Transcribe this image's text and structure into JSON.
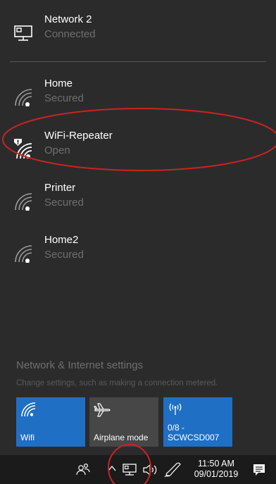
{
  "networks": [
    {
      "name": "Network 2",
      "status": "Connected",
      "icon": "ethernet-icon"
    },
    {
      "name": "Home",
      "status": "Secured",
      "icon": "wifi-secured-icon"
    },
    {
      "name": "WiFi-Repeater",
      "status": "Open",
      "icon": "wifi-warning-icon"
    },
    {
      "name": "Printer",
      "status": "Secured",
      "icon": "wifi-secured-icon"
    },
    {
      "name": "Home2",
      "status": "Secured",
      "icon": "wifi-secured-icon"
    }
  ],
  "settings": {
    "link": "Network & Internet settings",
    "description": "Change settings, such as making a connection metered."
  },
  "tiles": {
    "wifi": {
      "label": "Wifi",
      "icon": "wifi-icon"
    },
    "airplane": {
      "label": "Airplane mode",
      "icon": "airplane-icon"
    },
    "hotspot": {
      "line1": "0/8 -",
      "line2": "SCWCSD007",
      "icon": "hotspot-icon"
    }
  },
  "taskbar": {
    "time": "11:50 AM",
    "date": "09/01/2019",
    "icons": [
      "people-icon",
      "chevron-up-icon",
      "network-icon",
      "volume-icon",
      "pen-icon",
      "action-center-icon"
    ]
  },
  "colors": {
    "background": "#2b2b2b",
    "tile_active": "#1f6fc5",
    "tile_inactive": "#474747",
    "taskbar": "#1b1b1b",
    "annotation": "#cc2222"
  }
}
